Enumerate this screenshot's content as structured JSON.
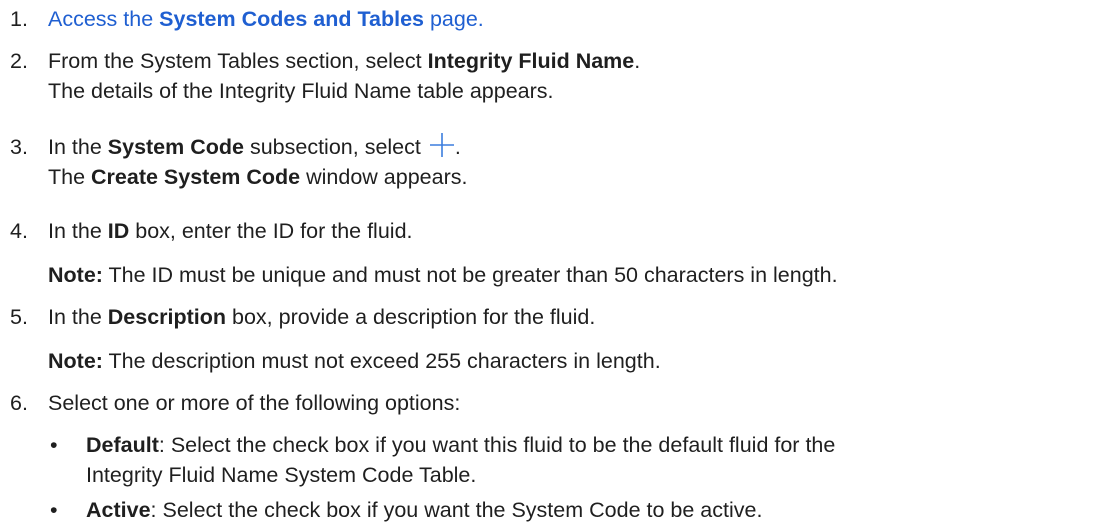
{
  "steps": [
    {
      "num": "1.",
      "pre": "Access the ",
      "link": "System Codes and Tables",
      "post": " page."
    },
    {
      "num": "2.",
      "pre": "From the System Tables section, select ",
      "bold": "Integrity Fluid Name",
      "post": ".",
      "result": "The details of the Integrity Fluid Name table appears."
    },
    {
      "num": "3.",
      "pre": "In the ",
      "bold": "System Code",
      "mid": " subsection, select ",
      "post": ".",
      "icon": "plus-icon",
      "result_bold": "Create System Code",
      "result_post": " window appears.",
      "result_pre": "The "
    },
    {
      "num": "4.",
      "pre": "In the ",
      "bold": "ID",
      "post": " box, enter the ID for the fluid.",
      "note_label": "Note:",
      "note_text": " The ID must be unique and must not be greater than 50 characters in length."
    },
    {
      "num": "5.",
      "pre": "In the ",
      "bold": "Description",
      "post": " box, provide a description for the fluid.",
      "note_label": "Note:",
      "note_text": " The description must not exceed 255 characters in length."
    },
    {
      "num": "6.",
      "text": "Select one or more of the following options:"
    }
  ],
  "options": [
    {
      "label": "Default",
      "text": ": Select the check box if you want this fluid to be the default fluid for the",
      "text2": "Integrity Fluid Name System Code Table."
    },
    {
      "label": "Active",
      "text": ": Select the check box if you want the System Code to be active."
    }
  ],
  "colors": {
    "link": "#1f5fd1",
    "icon": "#3b7ddd",
    "text": "#1f1f1f"
  }
}
